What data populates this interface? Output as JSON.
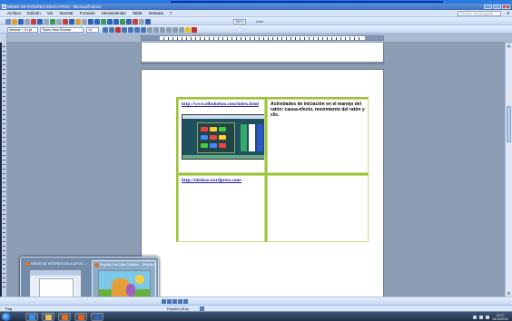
{
  "window": {
    "title": "WEBS DE INTERES EDUCATIVO - Microsoft Word",
    "buttons": [
      "_",
      "□",
      "X"
    ]
  },
  "menubar": {
    "items": [
      "Archivo",
      "Edición",
      "Ver",
      "Insertar",
      "Formato",
      "Herramientas",
      "Tabla",
      "Ventana",
      "?"
    ],
    "help_placeholder": "Escriba una pregunta",
    "close": "x"
  },
  "toolbar": {
    "zoom": "100%",
    "read_label": "Leer",
    "style": "Normal + 14 pt",
    "font": "Times New Roman",
    "size": "14"
  },
  "document": {
    "table": {
      "rows": [
        [
          {
            "link": "http://www.elbuhoboo.com/index.html"
          },
          {
            "text": "Actividades de iniciación en el manejo del ratón: causa-efecto, movimiento del ratón y clic."
          }
        ],
        [
          {
            "link": "http://mislase.wordpress.com/"
          },
          {
            "text": ""
          }
        ]
      ]
    }
  },
  "thumbnails": [
    {
      "label": "WEBS DE INTERES EDUCATIVO - Microsoft Word",
      "icon": "word-icon"
    },
    {
      "label": "English For Little Children - Mozilla Firefox",
      "icon": "firefox-icon"
    }
  ],
  "statusbar": {
    "page": "Pág",
    "language": "Español (Esp"
  },
  "taskbar": {
    "clock_time": "10:17",
    "clock_date": "14/10/2011",
    "apps": [
      {
        "icon": "ie-icon",
        "color": "#3a8fe0"
      },
      {
        "icon": "explorer-icon",
        "color": "#e8c15a"
      },
      {
        "icon": "media-player-icon",
        "color": "#e07020"
      },
      {
        "icon": "firefox-icon",
        "color": "#e0601a"
      },
      {
        "icon": "word-icon",
        "color": "#2d62b7"
      }
    ]
  },
  "colors": {
    "table_border": "#9bc43a",
    "link": "#2626a8",
    "title_bar": "#3f6fbd"
  }
}
